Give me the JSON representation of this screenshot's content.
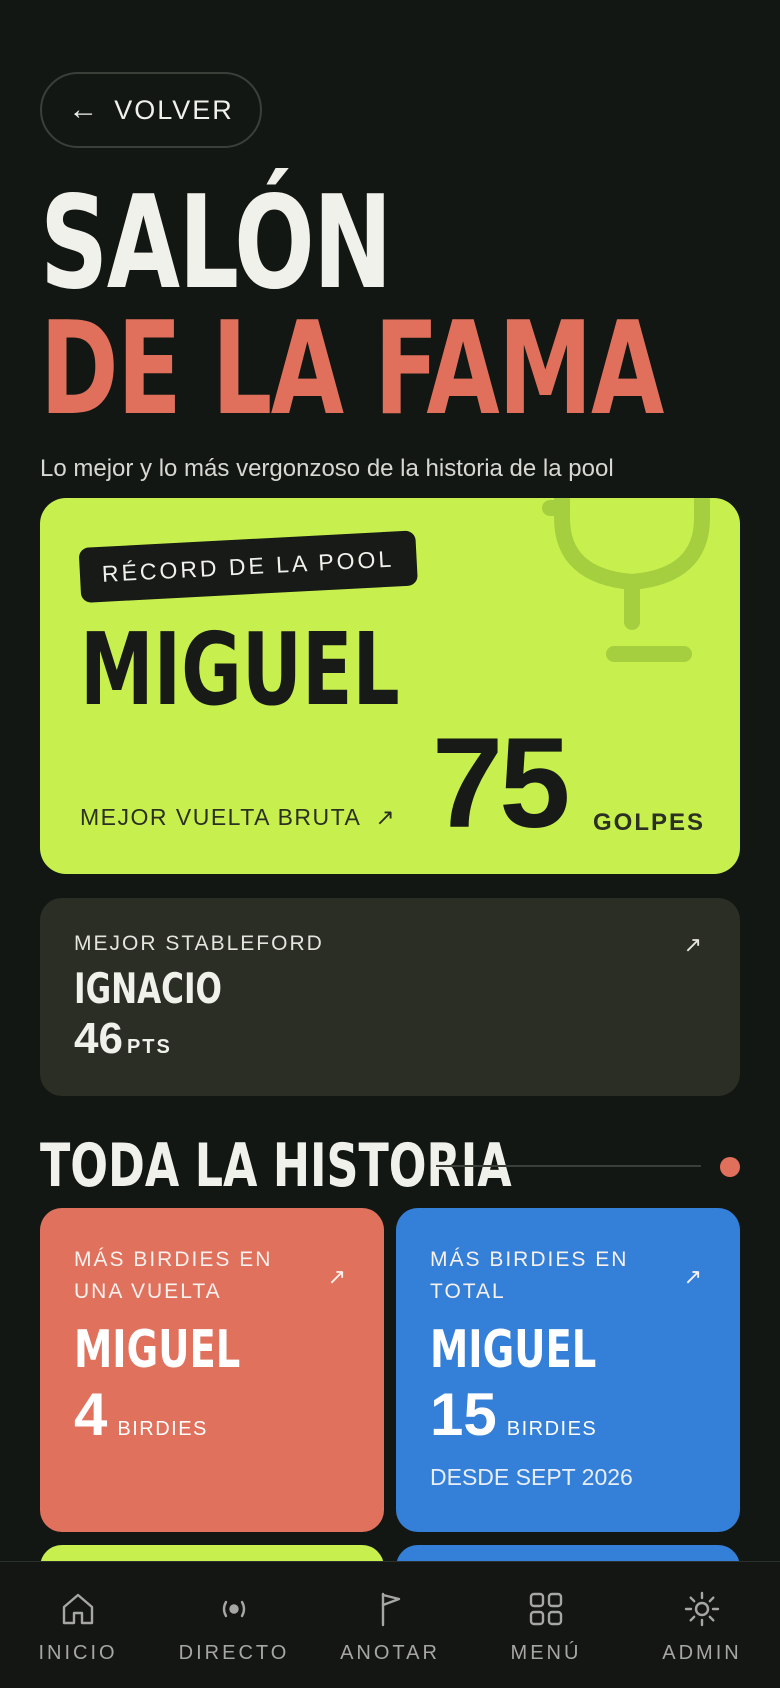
{
  "header": {
    "back_label": "VOLVER",
    "title_line1": "SALÓN",
    "title_line2": "DE LA FAMA",
    "subtitle": "Lo mejor y lo más vergonzoso de la historia de la pool"
  },
  "record": {
    "tag": "RÉCORD DE LA POOL",
    "name": "MIGUEL",
    "label": "MEJOR VUELTA BRUTA",
    "value": "75",
    "unit": "GOLPES"
  },
  "stableford": {
    "label": "MEJOR STABLEFORD",
    "name": "IGNACIO",
    "value": "46",
    "unit": "PTS"
  },
  "history": {
    "title": "TODA LA HISTORIA",
    "cards": [
      {
        "label": "MÁS BIRDIES EN UNA VUELTA",
        "name": "MIGUEL",
        "value": "4",
        "unit": "BIRDIES",
        "color": "#e0725d"
      },
      {
        "label": "MÁS BIRDIES EN TOTAL",
        "name": "MIGUEL",
        "value": "15",
        "unit": "BIRDIES",
        "note": "DESDE SEPT 2026",
        "color": "#347fd8"
      }
    ]
  },
  "nav": {
    "items": [
      {
        "label": "INICIO",
        "icon": "home-icon"
      },
      {
        "label": "DIRECTO",
        "icon": "live-broadcast-icon"
      },
      {
        "label": "ANOTAR",
        "icon": "flag-icon"
      },
      {
        "label": "MENÚ",
        "icon": "grid-icon"
      },
      {
        "label": "ADMIN",
        "icon": "sun-settings-icon"
      }
    ]
  },
  "colors": {
    "background": "#131714",
    "accent_lime": "#c7f04f",
    "accent_coral": "#e0705c",
    "accent_blue": "#347fd8"
  }
}
